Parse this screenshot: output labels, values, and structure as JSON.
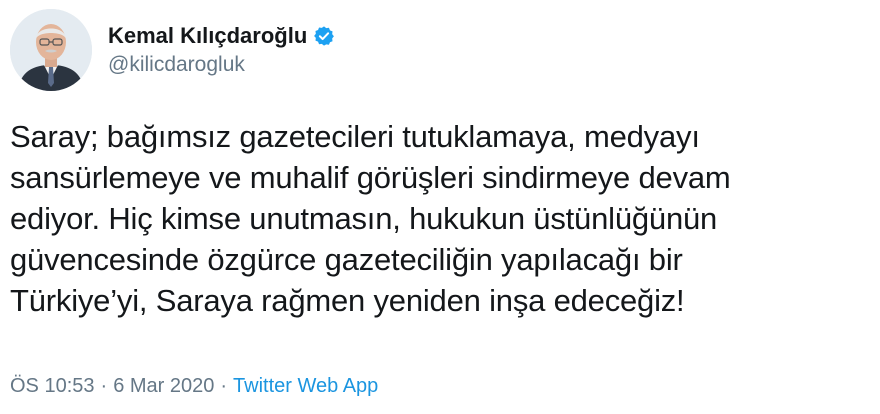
{
  "author": {
    "name": "Kemal Kılıçdaroğlu",
    "handle": "@kilicdarogluk",
    "verified_icon": "verified-badge-icon",
    "verified_color": "#1da1f2"
  },
  "tweet": {
    "text": "Saray; bağımsız gazetecileri tutuklamaya, medyayı\nsansürlemeye ve muhalif görüşleri sindirmeye devam\nediyor. Hiç kimse unutmasın, hukukun üstünlüğünün\ngüvencesinde özgürce gazeteciliğin yapılacağı bir\nTürkiye’yi, Saraya rağmen yeniden inşa edeceğiz!"
  },
  "meta": {
    "time": "ÖS 10:53",
    "separator": "·",
    "date": "6 Mar 2020",
    "source": "Twitter Web App",
    "link_color": "#1b95e0"
  }
}
